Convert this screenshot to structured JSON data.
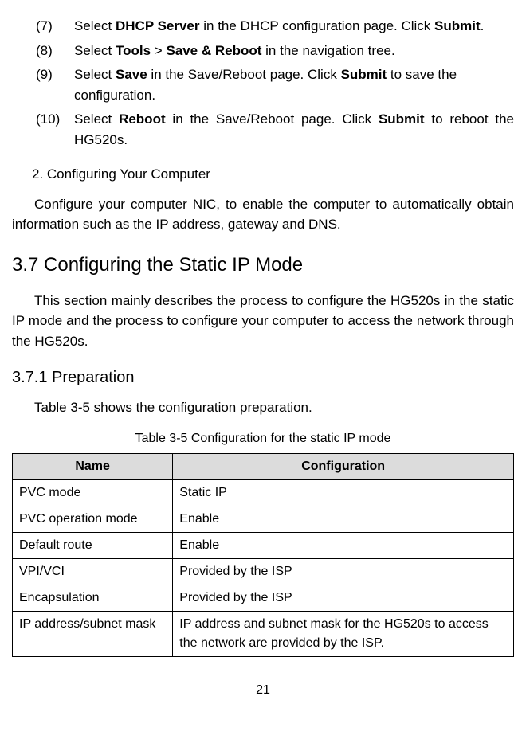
{
  "steps": [
    {
      "num": "(7)",
      "prefix": "Select ",
      "bold1": "DHCP Server",
      "mid1": " in the DHCP configuration page. Click ",
      "bold2": "Submit",
      "suffix": "."
    },
    {
      "num": "(8)",
      "prefix": "Select ",
      "bold1": "Tools",
      "mid1": " > ",
      "bold2": "Save & Reboot",
      "suffix": " in the navigation tree."
    },
    {
      "num": "(9)",
      "prefix": "Select ",
      "bold1": "Save",
      "mid1": " in the Save/Reboot page. Click ",
      "bold2": "Submit",
      "suffix": " to save the configuration."
    },
    {
      "num": "(10)",
      "prefix": "Select ",
      "bold1": "Reboot",
      "mid1": " in the Save/Reboot page. Click ",
      "bold2": "Submit",
      "suffix": " to reboot the HG520s."
    }
  ],
  "sub_heading_2": "2. Configuring Your Computer",
  "body_para_1": "Configure your computer NIC, to enable the computer to automatically obtain information such as the IP address, gateway and DNS.",
  "h2": "3.7  Configuring the Static IP Mode",
  "body_para_2": "This section mainly describes the process to configure the HG520s in the static IP mode and the process to configure your computer to access the network through the HG520s.",
  "h3": "3.7.1  Preparation",
  "body_para_3": "Table 3-5 shows the configuration preparation.",
  "table_caption": "Table 3-5 Configuration for the static IP mode",
  "table": {
    "headers": [
      "Name",
      "Configuration"
    ],
    "rows": [
      [
        "PVC mode",
        "Static IP"
      ],
      [
        "PVC operation mode",
        "Enable"
      ],
      [
        "Default route",
        "Enable"
      ],
      [
        "VPI/VCI",
        "Provided by the ISP"
      ],
      [
        "Encapsulation",
        "Provided by the ISP"
      ],
      [
        "IP address/subnet mask",
        "IP address and subnet mask for the HG520s to access the network are provided by the ISP."
      ]
    ]
  },
  "page_number": "21"
}
